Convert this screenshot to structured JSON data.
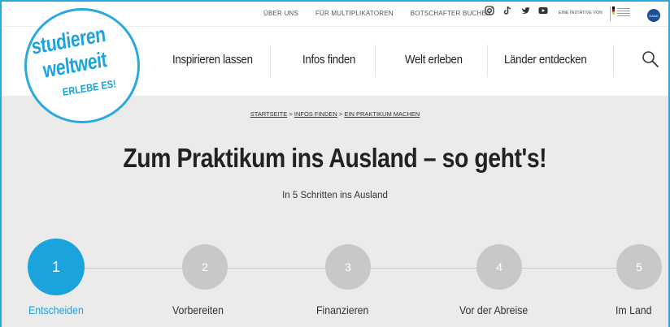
{
  "topbar": {
    "links": [
      "ÜBER UNS",
      "FÜR MULTIPLIKATOREN",
      "BOTSCHAFTER BUCHEN"
    ],
    "social_icons": [
      "instagram-icon",
      "tiktok-icon",
      "twitter-icon",
      "youtube-icon"
    ],
    "initiative_text": "EINE INITIATIVE VON",
    "partner_logo_text": "DAAD"
  },
  "logo": {
    "line1": "studieren",
    "line2": "weltweit",
    "line3": "ERLEBE ES!"
  },
  "nav": {
    "items": [
      "Inspirieren lassen",
      "Infos finden",
      "Welt erleben",
      "Länder entdecken"
    ],
    "search_icon": "search-icon"
  },
  "breadcrumb": {
    "items": [
      "STARTSEITE",
      "INFOS FINDEN",
      "EIN PRAKTIKUM MACHEN"
    ],
    "separator": ">"
  },
  "hero": {
    "title": "Zum Praktikum ins Ausland – so geht's!",
    "subtitle": "In 5 Schritten ins Ausland"
  },
  "steps": [
    {
      "number": "1",
      "label": "Entscheiden",
      "active": true
    },
    {
      "number": "2",
      "label": "Vorbereiten",
      "active": false
    },
    {
      "number": "3",
      "label": "Finanzieren",
      "active": false
    },
    {
      "number": "4",
      "label": "Vor der Abreise",
      "active": false
    },
    {
      "number": "5",
      "label": "Im Land",
      "active": false
    }
  ],
  "colors": {
    "accent": "#1aa3dd",
    "hero_bg": "#ebebeb",
    "step_idle": "#c8c8c8"
  }
}
